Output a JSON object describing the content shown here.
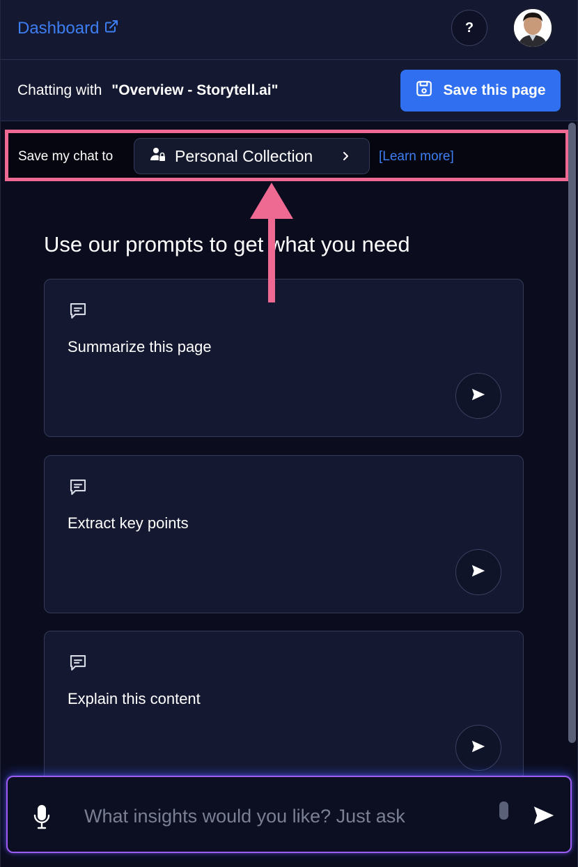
{
  "header": {
    "dashboard_label": "Dashboard",
    "help_label": "?"
  },
  "context": {
    "chatting_prefix": "Chatting with",
    "page_title": "\"Overview - Storytell.ai\"",
    "save_page_label": "Save this page"
  },
  "save_chat": {
    "label": "Save my chat to",
    "collection": "Personal Collection",
    "learn_more": "[Learn more]"
  },
  "prompts": {
    "heading": "Use our prompts to get what you need",
    "items": [
      {
        "label": "Summarize this page"
      },
      {
        "label": "Extract key points"
      },
      {
        "label": "Explain this content"
      }
    ]
  },
  "input": {
    "placeholder": "What insights would you like? Just ask"
  },
  "colors": {
    "accent": "#2f6ff0",
    "link": "#3d7ef2",
    "highlight": "#ee6a93",
    "background": "#0b0d1f"
  }
}
